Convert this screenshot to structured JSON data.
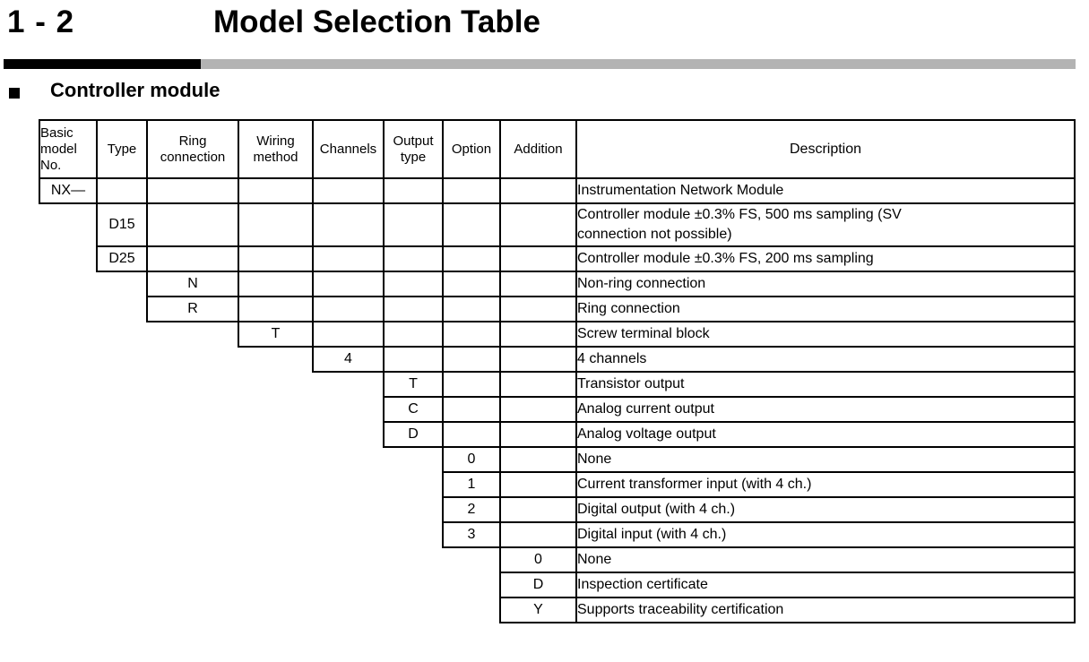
{
  "page": {
    "section_number": "1 - 2",
    "section_title": "Model Selection Table",
    "subheading": "Controller module",
    "bullet_icon": "filled-square-bullet",
    "rule_dark_color": "#000000",
    "rule_light_color": "#b3b3b3"
  },
  "table": {
    "headers": {
      "basic_model_no": "Basic\nmodel\nNo.",
      "basic_model_no_lines": [
        "Basic",
        "model",
        "No."
      ],
      "type": "Type",
      "ring_connection_lines": [
        "Ring",
        "connection"
      ],
      "wiring_method_lines": [
        "Wiring",
        "method"
      ],
      "channels": "Channels",
      "output_type_lines": [
        "Output",
        "type"
      ],
      "option": "Option",
      "addition": "Addition",
      "description": "Description"
    },
    "rows": [
      {
        "col": 0,
        "code": "NX—",
        "description": "Instrumentation Network Module",
        "tall": false
      },
      {
        "col": 1,
        "code": "D15",
        "description": "Controller module ±0.3% FS, 500 ms sampling (SV connection not possible)",
        "description_line1": "Controller module ±0.3% FS, 500 ms sampling (SV",
        "description_line2": "connection not possible)",
        "tall": true
      },
      {
        "col": 1,
        "code": "D25",
        "description": "Controller module ±0.3% FS, 200 ms sampling",
        "tall": false
      },
      {
        "col": 2,
        "code": "N",
        "description": "Non-ring connection",
        "tall": false
      },
      {
        "col": 2,
        "code": "R",
        "description": "Ring connection",
        "tall": false
      },
      {
        "col": 3,
        "code": "T",
        "description": "Screw terminal block",
        "tall": false
      },
      {
        "col": 4,
        "code": "4",
        "description": "4 channels",
        "tall": false
      },
      {
        "col": 5,
        "code": "T",
        "description": "Transistor output",
        "tall": false
      },
      {
        "col": 5,
        "code": "C",
        "description": "Analog current output",
        "tall": false
      },
      {
        "col": 5,
        "code": "D",
        "description": "Analog voltage output",
        "tall": false
      },
      {
        "col": 6,
        "code": "0",
        "description": "None",
        "tall": false
      },
      {
        "col": 6,
        "code": "1",
        "description": "Current transformer input (with 4 ch.)",
        "tall": false
      },
      {
        "col": 6,
        "code": "2",
        "description": "Digital output (with 4 ch.)",
        "tall": false
      },
      {
        "col": 6,
        "code": "3",
        "description": "Digital input (with 4 ch.)",
        "tall": false
      },
      {
        "col": 7,
        "code": "0",
        "description": "None",
        "tall": false
      },
      {
        "col": 7,
        "code": "D",
        "description": "Inspection certificate",
        "tall": false
      },
      {
        "col": 7,
        "code": "Y",
        "description": "Supports traceability certification",
        "tall": false
      }
    ]
  }
}
